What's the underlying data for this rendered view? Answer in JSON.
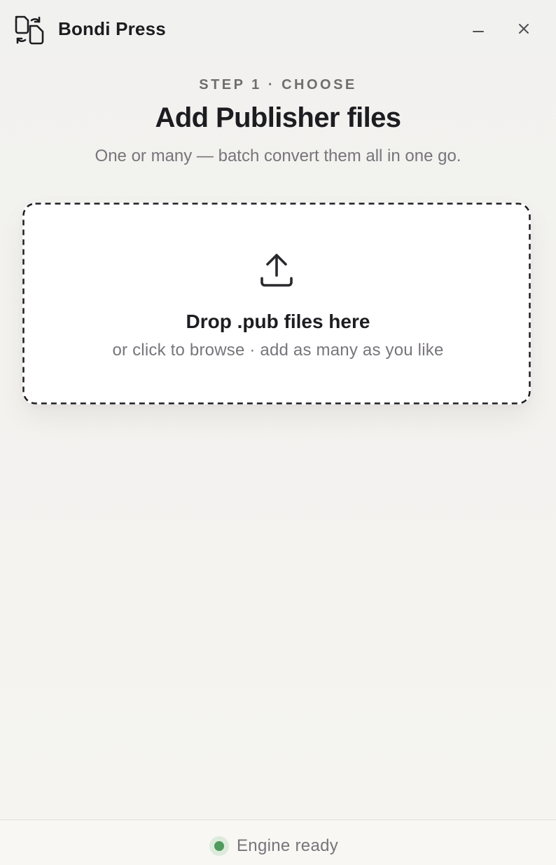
{
  "app": {
    "name": "Bondi Press",
    "logo_icon": "file-convert-icon"
  },
  "window_controls": {
    "minimize_icon": "minimize-icon",
    "close_icon": "close-icon"
  },
  "header": {
    "step_label": "STEP 1 · CHOOSE",
    "title": "Add Publisher files",
    "subtitle": "One or many — batch convert them all in one go."
  },
  "dropzone": {
    "icon": "upload-icon",
    "title": "Drop .pub files here",
    "hint": "or click to browse · add as many as you like"
  },
  "status": {
    "text": "Engine ready",
    "color": "#4f9a5c"
  }
}
